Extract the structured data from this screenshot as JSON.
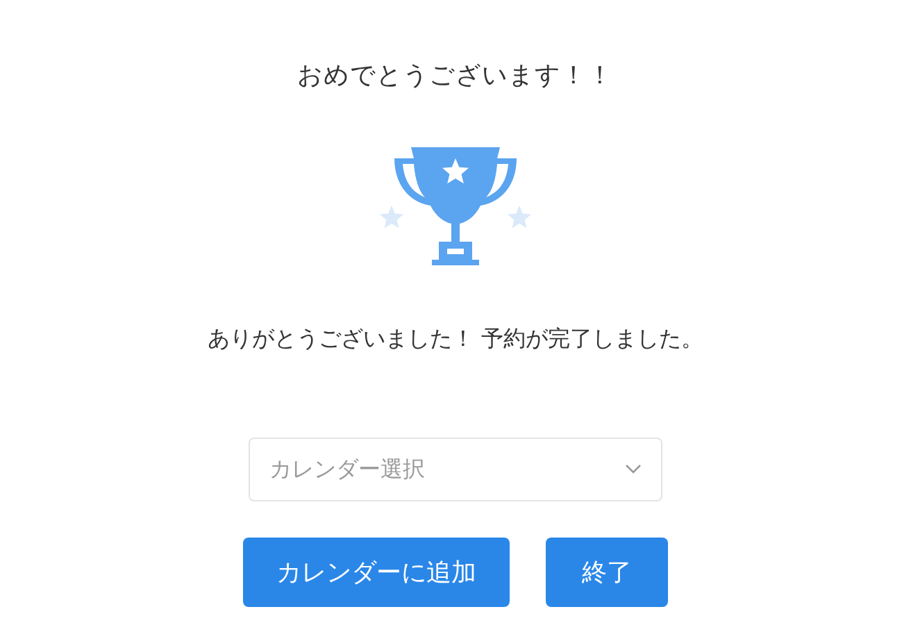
{
  "heading": "おめでとうございます！！",
  "message": "ありがとうございました！ 予約が完了しました。",
  "calendar_select": {
    "placeholder": "カレンダー選択"
  },
  "buttons": [
    {
      "label": "カレンダーに追加",
      "kind": "primary"
    },
    {
      "label": "終了",
      "kind": "primary"
    }
  ]
}
